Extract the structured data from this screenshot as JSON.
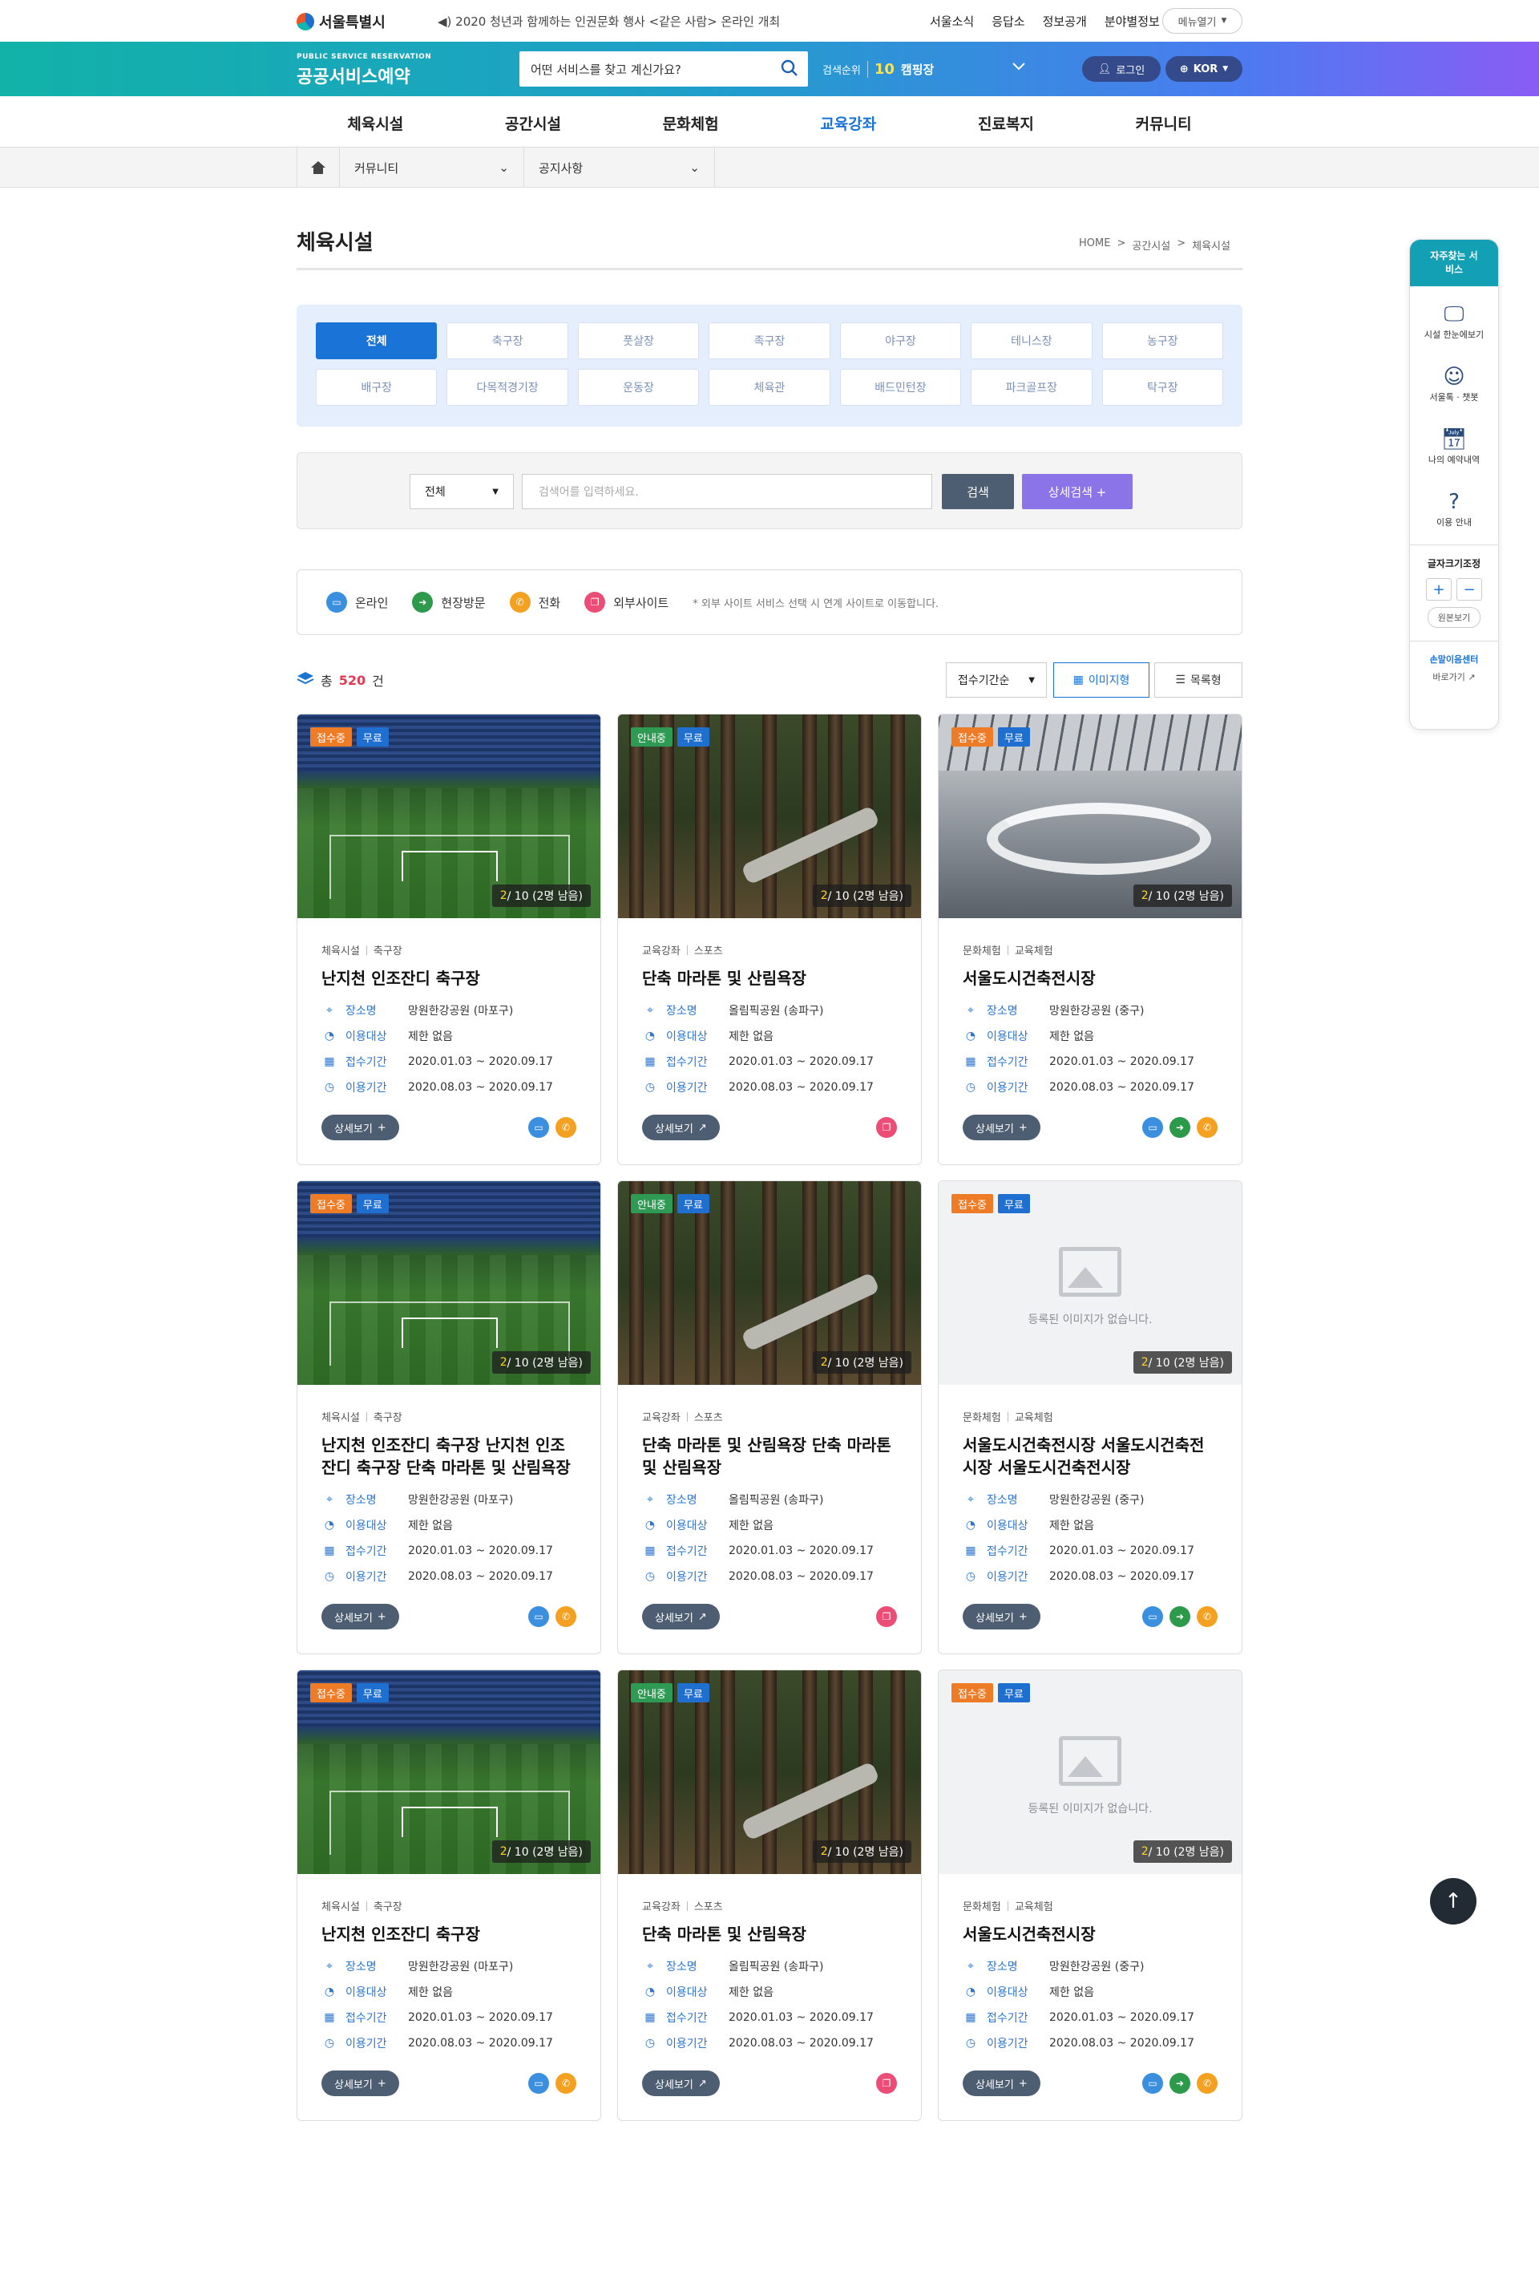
{
  "util": {
    "logo": "서울특별시",
    "notice": "2020 청년과 함께하는 인권문화 행사 <같은 사람> 온라인 개최",
    "links": [
      "서울소식",
      "응답소",
      "정보공개",
      "분야별정보"
    ],
    "menu_open": "메뉴열기"
  },
  "header": {
    "brand_en": "PUBLIC SERVICE RESERVATION",
    "brand_ko": "공공서비스예약",
    "search_placeholder": "어떤 서비스를 찾고 계신가요?",
    "rank_label": "검색순위",
    "rank_num": "10",
    "rank_keyword": "캠핑장",
    "login": "로그인",
    "lang": "KOR"
  },
  "gnb": [
    "체육시설",
    "공간시설",
    "문화체험",
    "교육강좌",
    "진료복지",
    "커뮤니티"
  ],
  "location": {
    "dd1": "커뮤니티",
    "dd2": "공지사항"
  },
  "page": {
    "title": "체육시설",
    "crumbs": [
      "HOME",
      ">",
      "공간시설",
      ">",
      "체육시설"
    ]
  },
  "categories": [
    "전체",
    "축구장",
    "풋살장",
    "족구장",
    "야구장",
    "테니스장",
    "농구장",
    "배구장",
    "다목적경기장",
    "운동장",
    "체육관",
    "배드민턴장",
    "파크골프장",
    "탁구장"
  ],
  "search": {
    "select": "전체",
    "placeholder": "검색어를 입력하세요.",
    "btn": "검색",
    "detail_btn": "상세검색 +"
  },
  "legend": {
    "online": "온라인",
    "visit": "현장방문",
    "phone": "전화",
    "external": "외부사이트",
    "note": "* 외부 사이트 서비스 선택 시 연계 사이트로 이동합니다."
  },
  "result": {
    "total_prefix": "총",
    "total_count": "520",
    "total_suffix": "건",
    "sort": "접수기간순",
    "view_image": "이미지형",
    "view_list": "목록형"
  },
  "card_labels": {
    "place": "장소명",
    "target": "이용대상",
    "apply": "접수기간",
    "use": "이용기간",
    "detail": "상세보기",
    "no_image": "등록된 이미지가 없습니다."
  },
  "cards": [
    {
      "status": "접수중",
      "status_color": "orange",
      "fee": "무료",
      "remain_y": "2",
      "remain_rest": " / 10 (2명 남음)",
      "cat1": "체육시설",
      "cat2": "축구장",
      "title": "난지천 인조잔디 축구장",
      "place": "망원한강공원 (마포구)",
      "target": "제한 없음",
      "apply": "2020.01.03 ~ 2020.09.17",
      "use": "2020.08.03 ~ 2020.09.17"
    },
    {
      "status": "안내중",
      "status_color": "green",
      "fee": "무료",
      "remain_y": "2",
      "remain_rest": " / 10 (2명 남음)",
      "cat1": "교육강좌",
      "cat2": "스포츠",
      "title": "단축 마라톤 및 산림욕장",
      "place": "올림픽공원 (송파구)",
      "target": "제한 없음",
      "apply": "2020.01.03 ~ 2020.09.17",
      "use": "2020.08.03 ~ 2020.09.17"
    },
    {
      "status": "접수중",
      "status_color": "orange",
      "fee": "무료",
      "remain_y": "2",
      "remain_rest": " / 10 (2명 남음)",
      "cat1": "문화체험",
      "cat2": "교육체험",
      "title": "서울도시건축전시장",
      "place": "망원한강공원 (중구)",
      "target": "제한 없음",
      "apply": "2020.01.03 ~ 2020.09.17",
      "use": "2020.08.03 ~ 2020.09.17"
    },
    {
      "status": "접수중",
      "status_color": "orange",
      "fee": "무료",
      "remain_y": "2",
      "remain_rest": " / 10 (2명 남음)",
      "cat1": "체육시설",
      "cat2": "축구장",
      "title": "난지천 인조잔디 축구장 난지천 인조잔디 축구장 단축 마라톤 및 산림욕장",
      "place": "망원한강공원 (마포구)",
      "target": "제한 없음",
      "apply": "2020.01.03 ~ 2020.09.17",
      "use": "2020.08.03 ~ 2020.09.17"
    },
    {
      "status": "안내중",
      "status_color": "green",
      "fee": "무료",
      "remain_y": "2",
      "remain_rest": " / 10 (2명 남음)",
      "cat1": "교육강좌",
      "cat2": "스포츠",
      "title": "단축 마라톤 및 산림욕장 단축 마라톤 및 산림욕장",
      "place": "올림픽공원 (송파구)",
      "target": "제한 없음",
      "apply": "2020.01.03 ~ 2020.09.17",
      "use": "2020.08.03 ~ 2020.09.17"
    },
    {
      "status": "접수중",
      "status_color": "orange",
      "fee": "무료",
      "remain_y": "2",
      "remain_rest": " / 10 (2명 남음)",
      "cat1": "문화체험",
      "cat2": "교육체험",
      "title": "서울도시건축전시장 서울도시건축전시장 서울도시건축전시장",
      "place": "망원한강공원 (중구)",
      "target": "제한 없음",
      "apply": "2020.01.03 ~ 2020.09.17",
      "use": "2020.08.03 ~ 2020.09.17"
    },
    {
      "status": "접수중",
      "status_color": "orange",
      "fee": "무료",
      "remain_y": "2",
      "remain_rest": " / 10 (2명 남음)",
      "cat1": "체육시설",
      "cat2": "축구장",
      "title": "난지천 인조잔디 축구장",
      "place": "망원한강공원 (마포구)",
      "target": "제한 없음",
      "apply": "2020.01.03 ~ 2020.09.17",
      "use": "2020.08.03 ~ 2020.09.17"
    },
    {
      "status": "안내중",
      "status_color": "green",
      "fee": "무료",
      "remain_y": "2",
      "remain_rest": " / 10 (2명 남음)",
      "cat1": "교육강좌",
      "cat2": "스포츠",
      "title": "단축 마라톤 및 산림욕장",
      "place": "올림픽공원 (송파구)",
      "target": "제한 없음",
      "apply": "2020.01.03 ~ 2020.09.17",
      "use": "2020.08.03 ~ 2020.09.17"
    },
    {
      "status": "접수중",
      "status_color": "orange",
      "fee": "무료",
      "remain_y": "2",
      "remain_rest": " / 10 (2명 남음)",
      "cat1": "문화체험",
      "cat2": "교육체험",
      "title": "서울도시건축전시장",
      "place": "망원한강공원 (중구)",
      "target": "제한 없음",
      "apply": "2020.01.03 ~ 2020.09.17",
      "use": "2020.08.03 ~ 2020.09.17"
    }
  ],
  "quick": {
    "head": "자주찾는 서비스",
    "items": [
      "시설 한눈에보기",
      "서울톡 · 챗봇",
      "나의 예약내역",
      "이용 안내"
    ],
    "font_title": "글자크기조정",
    "plus": "+",
    "minus": "−",
    "orig": "원본보기",
    "sign_logo": "손말이음센터",
    "sign_link": "바로가기"
  },
  "colors": {
    "accent": "#1a73d6",
    "orange": "#ee7b26",
    "green": "#2e9a54",
    "blue": "#1f6fd0"
  }
}
